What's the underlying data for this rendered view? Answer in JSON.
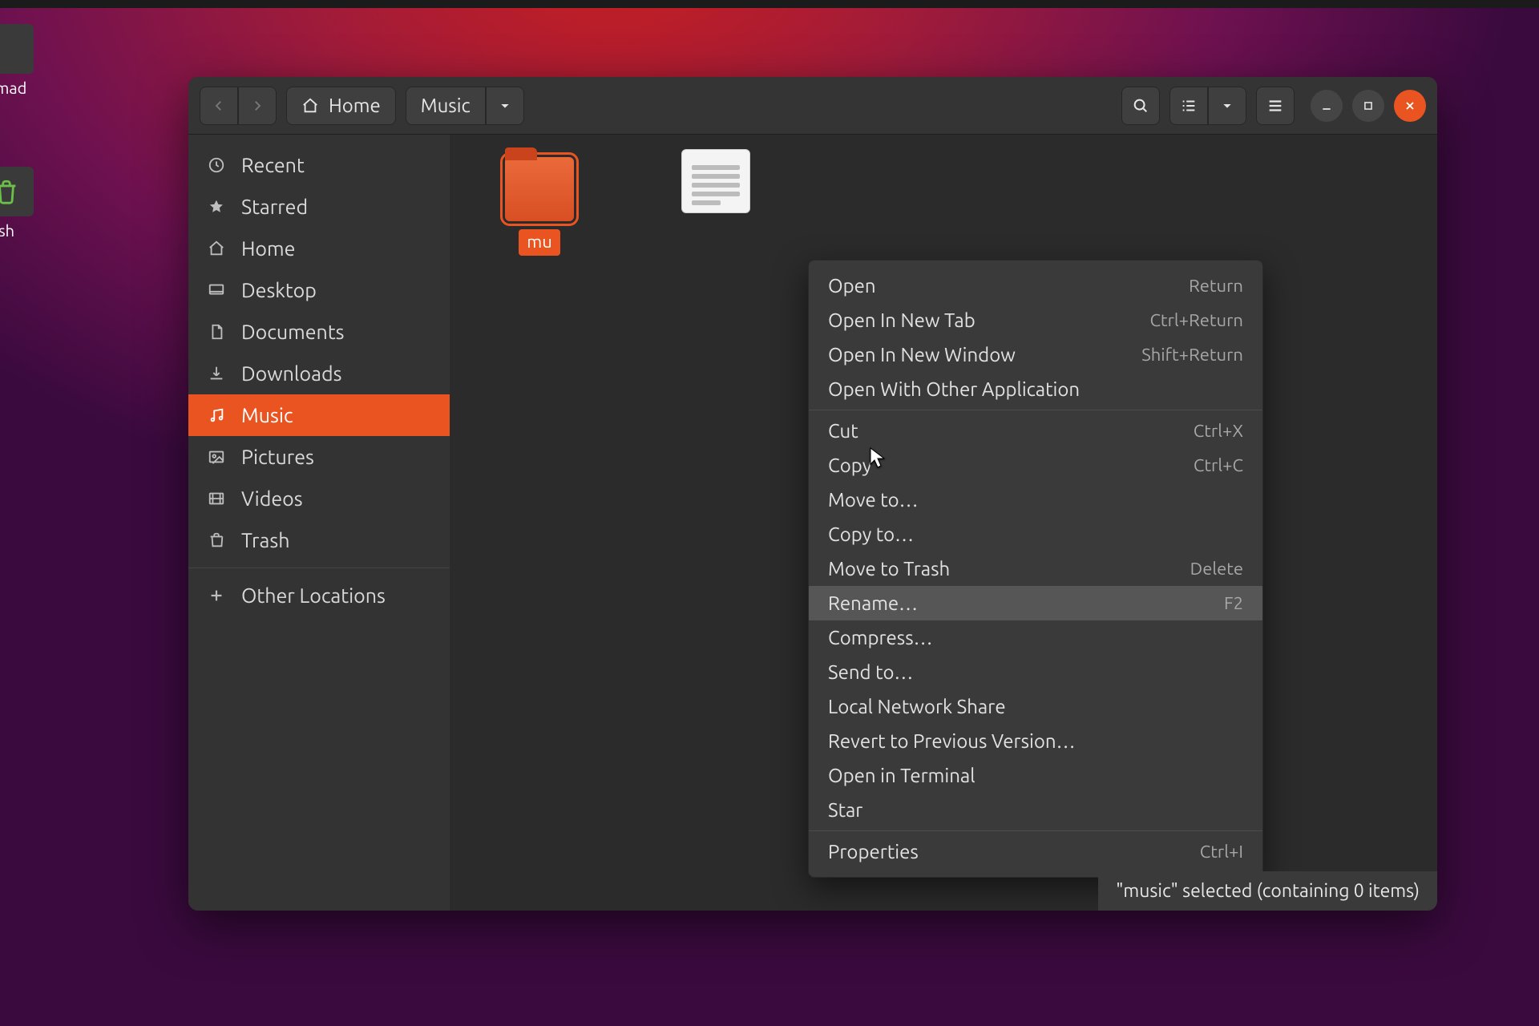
{
  "desktop": {
    "icon1_label": "nmad",
    "trash_label": "sh"
  },
  "titlebar": {
    "home": "Home",
    "path_current": "Music"
  },
  "sidebar": {
    "items": [
      {
        "label": "Recent"
      },
      {
        "label": "Starred"
      },
      {
        "label": "Home"
      },
      {
        "label": "Desktop"
      },
      {
        "label": "Documents"
      },
      {
        "label": "Downloads"
      },
      {
        "label": "Music"
      },
      {
        "label": "Pictures"
      },
      {
        "label": "Videos"
      },
      {
        "label": "Trash"
      }
    ],
    "other": "Other Locations"
  },
  "files": {
    "folder_name": "mu",
    "doc_name": ""
  },
  "context_menu": {
    "items": [
      {
        "label": "Open",
        "accel": "Return"
      },
      {
        "label": "Open In New Tab",
        "accel": "Ctrl+Return"
      },
      {
        "label": "Open In New Window",
        "accel": "Shift+Return"
      },
      {
        "label": "Open With Other Application",
        "accel": ""
      },
      {
        "sep": true
      },
      {
        "label": "Cut",
        "accel": "Ctrl+X"
      },
      {
        "label": "Copy",
        "accel": "Ctrl+C"
      },
      {
        "label": "Move to…",
        "accel": ""
      },
      {
        "label": "Copy to…",
        "accel": ""
      },
      {
        "label": "Move to Trash",
        "accel": "Delete"
      },
      {
        "label": "Rename…",
        "accel": "F2",
        "hover": true
      },
      {
        "label": "Compress…",
        "accel": ""
      },
      {
        "label": "Send to…",
        "accel": ""
      },
      {
        "label": "Local Network Share",
        "accel": ""
      },
      {
        "label": "Revert to Previous Version…",
        "accel": ""
      },
      {
        "label": "Open in Terminal",
        "accel": ""
      },
      {
        "label": "Star",
        "accel": ""
      },
      {
        "sep": true
      },
      {
        "label": "Properties",
        "accel": "Ctrl+I"
      }
    ]
  },
  "statusbar": {
    "text": "\"music\" selected  (containing 0 items)"
  }
}
